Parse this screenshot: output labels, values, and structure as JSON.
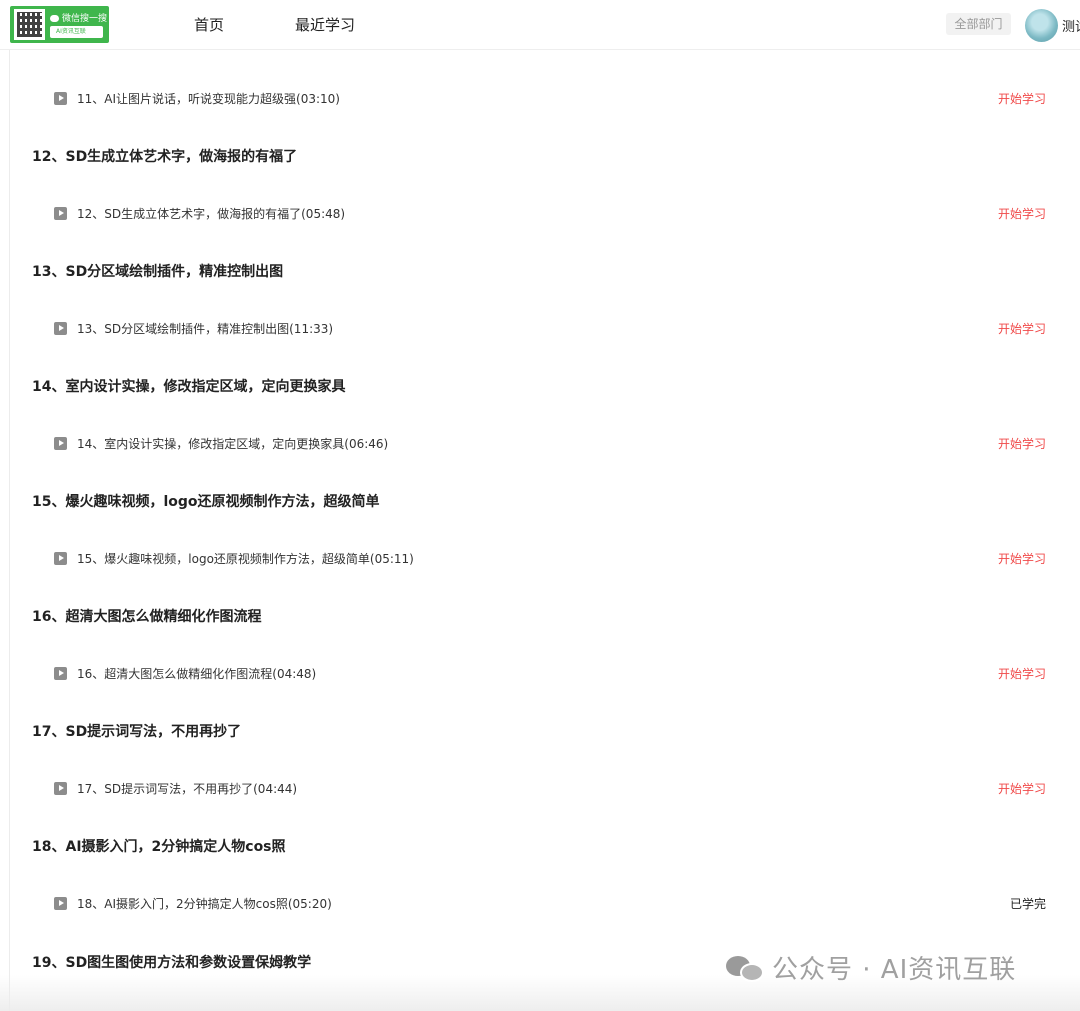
{
  "header": {
    "logo": {
      "line1": "微信搜一搜",
      "line2": "AI资讯互联"
    },
    "nav": [
      "首页",
      "最近学习"
    ],
    "department_button": "全部部门",
    "username": "测试"
  },
  "chapters": [
    {
      "title": "",
      "lesson": "11、AI让图片说话，听说变现能力超级强(03:10)",
      "action": "开始学习",
      "done": false
    },
    {
      "title": "12、SD生成立体艺术字，做海报的有福了",
      "lesson": "12、SD生成立体艺术字，做海报的有福了(05:48)",
      "action": "开始学习",
      "done": false
    },
    {
      "title": "13、SD分区域绘制插件，精准控制出图",
      "lesson": "13、SD分区域绘制插件，精准控制出图(11:33)",
      "action": "开始学习",
      "done": false
    },
    {
      "title": "14、室内设计实操，修改指定区域，定向更换家具",
      "lesson": "14、室内设计实操，修改指定区域，定向更换家具(06:46)",
      "action": "开始学习",
      "done": false
    },
    {
      "title": "15、爆火趣味视频，logo还原视频制作方法，超级简单",
      "lesson": "15、爆火趣味视频，logo还原视频制作方法，超级简单(05:11)",
      "action": "开始学习",
      "done": false
    },
    {
      "title": "16、超清大图怎么做精细化作图流程",
      "lesson": "16、超清大图怎么做精细化作图流程(04:48)",
      "action": "开始学习",
      "done": false
    },
    {
      "title": "17、SD提示词写法，不用再抄了",
      "lesson": "17、SD提示词写法，不用再抄了(04:44)",
      "action": "开始学习",
      "done": false
    },
    {
      "title": "18、AI摄影入门，2分钟搞定人物cos照",
      "lesson": "18、AI摄影入门，2分钟搞定人物cos照(05:20)",
      "action": "已学完",
      "done": true
    },
    {
      "title": "19、SD图生图使用方法和参数设置保姆教学",
      "lesson": "",
      "action": "",
      "done": false
    }
  ],
  "watermark": "公众号 · AI资讯互联",
  "colors": {
    "accent_red": "#f04a4a",
    "logo_green": "#3fb64c"
  }
}
